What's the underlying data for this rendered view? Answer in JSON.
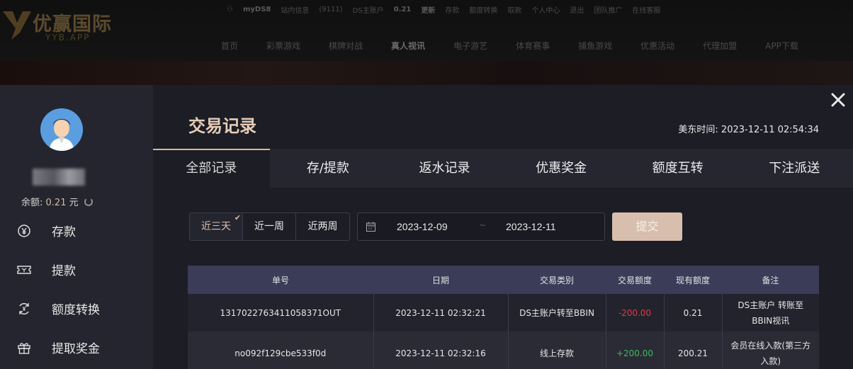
{
  "site": {
    "brand": "优赢国际",
    "brand_sub": "YYB.APP",
    "top_links": [
      "myDS8",
      "站内信息",
      "(9111)",
      "DS主账户",
      "0.21",
      "更新",
      "存款",
      "额度转换",
      "取款",
      "个人中心",
      "退出",
      "团队推广",
      "在线客服"
    ],
    "nav": [
      "首页",
      "彩票游戏",
      "棋牌对战",
      "真人视讯",
      "电子游艺",
      "体育赛事",
      "捕鱼游戏",
      "优惠活动",
      "代理加盟",
      "APP下载"
    ],
    "nav_active_index": 3
  },
  "sidebar": {
    "balance_label": "余额:",
    "balance_value": "0.21",
    "balance_unit": "元",
    "menu": [
      {
        "label": "存款",
        "icon": "yen-circle-icon"
      },
      {
        "label": "提款",
        "icon": "ticket-icon"
      },
      {
        "label": "额度转换",
        "icon": "exchange-icon"
      },
      {
        "label": "提取奖金",
        "icon": "gift-icon"
      }
    ]
  },
  "panel": {
    "title": "交易记录",
    "time_label": "美东时间:",
    "time_value": "2023-12-11 02:54:34",
    "tabs": [
      "全部记录",
      "存/提款",
      "返水记录",
      "优惠奖金",
      "额度互转",
      "下注派送"
    ],
    "active_tab": 0
  },
  "filters": {
    "ranges": [
      "近三天",
      "近一周",
      "近两周"
    ],
    "active_range": 0,
    "date_from": "2023-12-09",
    "date_sep": "~",
    "date_to": "2023-12-11",
    "submit_label": "提交"
  },
  "table": {
    "headers": [
      "单号",
      "日期",
      "交易类别",
      "交易额度",
      "现有额度",
      "备注"
    ],
    "rows": [
      [
        "1317022763411058371OUT",
        "2023-12-11 02:32:21",
        "DS主账户转至BBIN",
        "-200.00",
        "0.21",
        "DS主账户 转账至 BBIN视讯"
      ],
      [
        "no092f129cbe533f0d",
        "2023-12-11 02:32:16",
        "线上存款",
        "+200.00",
        "200.21",
        "会员在线入款(第三方入款)"
      ]
    ]
  },
  "colors": {
    "accent": "#d8b99a",
    "negative": "#e0384a",
    "positive": "#3cbd5a",
    "header_row": "#3a3c58"
  }
}
